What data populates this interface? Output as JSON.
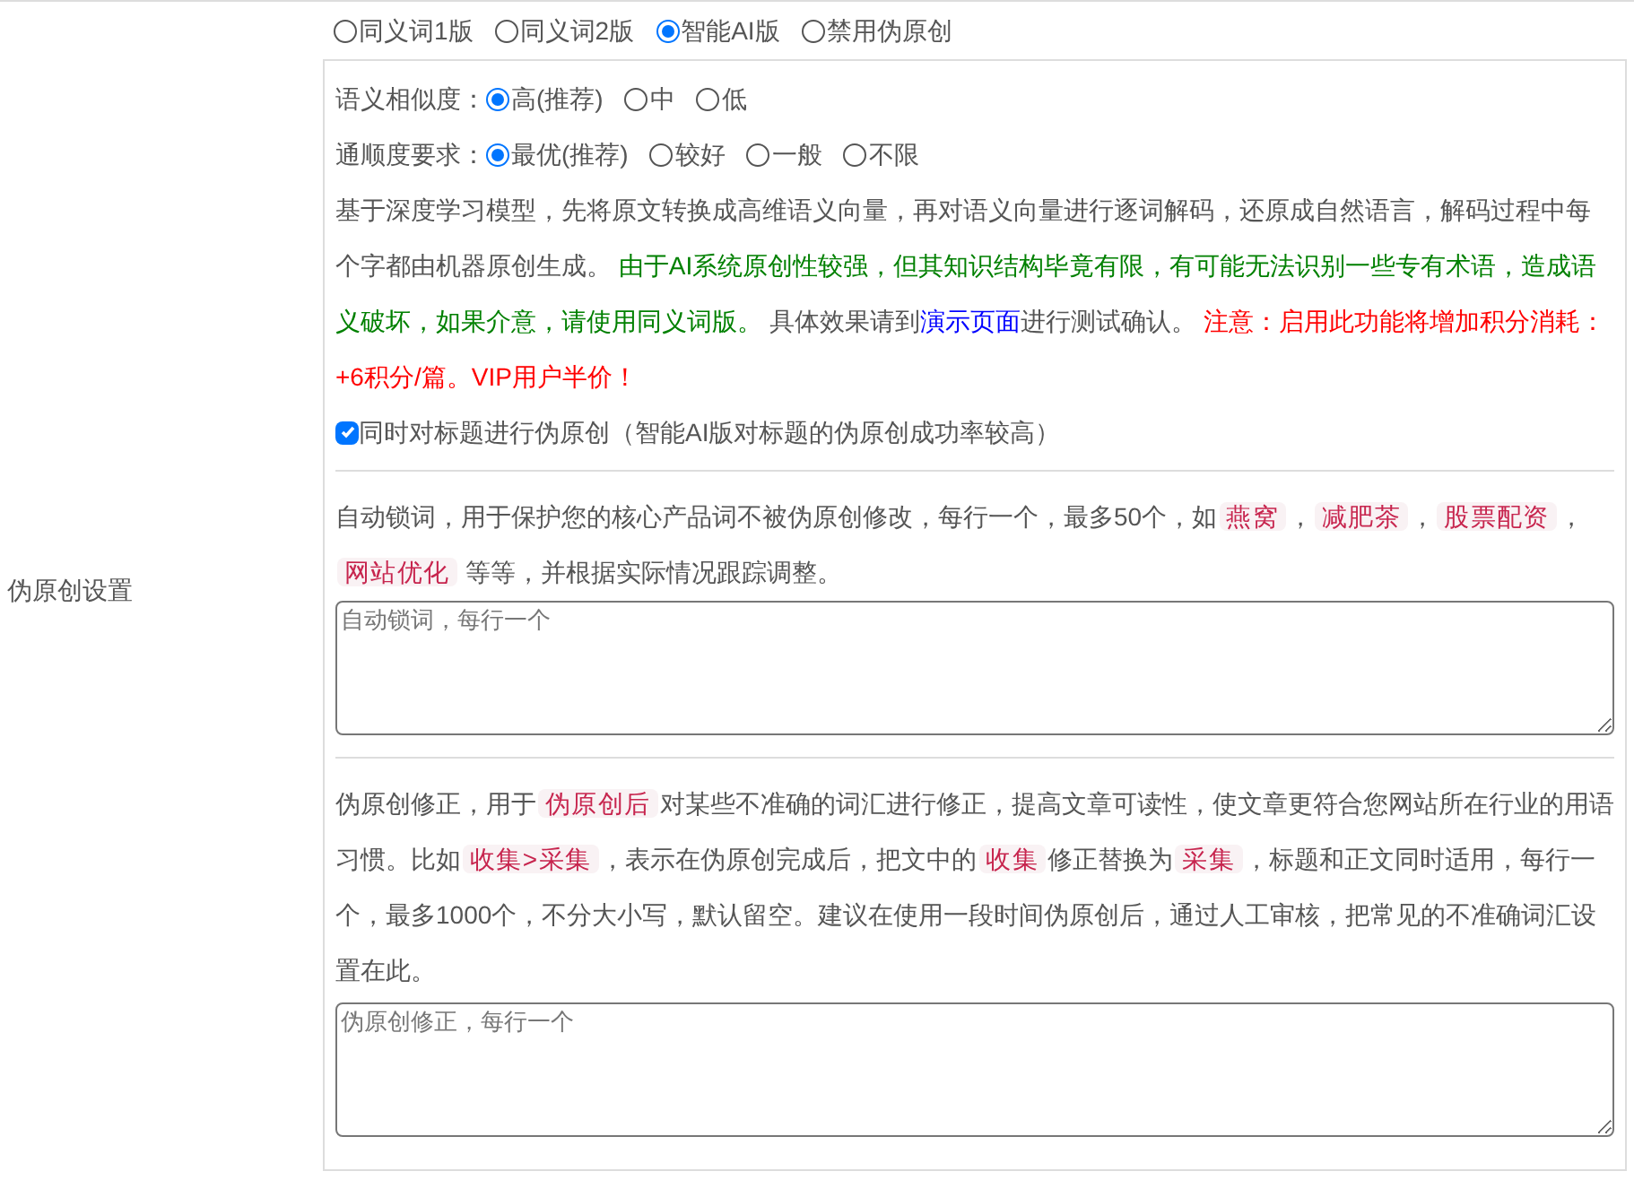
{
  "section_label": "伪原创设置",
  "modes": [
    {
      "label": "同义词1版",
      "selected": false
    },
    {
      "label": "同义词2版",
      "selected": false
    },
    {
      "label": "智能AI版",
      "selected": true
    },
    {
      "label": "禁用伪原创",
      "selected": false
    }
  ],
  "option_groups": [
    {
      "label": "语义相似度：",
      "options": [
        {
          "label": "高(推荐)",
          "selected": true
        },
        {
          "label": "中",
          "selected": false
        },
        {
          "label": "低",
          "selected": false
        }
      ]
    },
    {
      "label": "通顺度要求：",
      "options": [
        {
          "label": "最优(推荐)",
          "selected": true
        },
        {
          "label": "较好",
          "selected": false
        },
        {
          "label": "一般",
          "selected": false
        },
        {
          "label": "不限",
          "selected": false
        }
      ]
    }
  ],
  "ai_description": [
    {
      "kind": "plain",
      "text": "基于深度学习模型，先将原文转换成高维语义向量，再对语义向量进行逐词解码，还原成自然语言，解码过程中每个字都由机器原创生成。 "
    },
    {
      "kind": "green",
      "text": "由于AI系统原创性较强，但其知识结构毕竟有限，有可能无法识别一些专有术语，造成语义破坏，如果介意，请使用同义词版。"
    },
    {
      "kind": "plain",
      "text": " 具体效果请到"
    },
    {
      "kind": "link",
      "text": "演示页面"
    },
    {
      "kind": "plain",
      "text": "进行测试确认。 "
    },
    {
      "kind": "red",
      "text": "注意：启用此功能将增加积分消耗：+6积分/篇。VIP用户半价！"
    }
  ],
  "title_option": {
    "label": "同时对标题进行伪原创（智能AI版对标题的伪原创成功率较高）",
    "checked": true
  },
  "lock_words": {
    "description": [
      {
        "kind": "plain",
        "text": "自动锁词，用于保护您的核心产品词不被伪原创修改，每行一个，最多50个，如"
      },
      {
        "kind": "code",
        "text": "燕窝"
      },
      {
        "kind": "plain",
        "text": "，"
      },
      {
        "kind": "code",
        "text": "减肥茶"
      },
      {
        "kind": "plain",
        "text": "，"
      },
      {
        "kind": "code",
        "text": "股票配资"
      },
      {
        "kind": "plain",
        "text": "，"
      },
      {
        "kind": "code",
        "text": "网站优化"
      },
      {
        "kind": "plain",
        "text": " 等等，并根据实际情况跟踪调整。"
      }
    ],
    "placeholder": "自动锁词，每行一个"
  },
  "corrections": {
    "description": [
      {
        "kind": "plain",
        "text": "伪原创修正，用于"
      },
      {
        "kind": "code",
        "text": "伪原创后"
      },
      {
        "kind": "plain",
        "text": "对某些不准确的词汇进行修正，提高文章可读性，使文章更符合您网站所在行业的用语习惯。比如"
      },
      {
        "kind": "code",
        "text": "收集>采集"
      },
      {
        "kind": "plain",
        "text": "，表示在伪原创完成后，把文中的"
      },
      {
        "kind": "code",
        "text": "收集"
      },
      {
        "kind": "plain",
        "text": "修正替换为"
      },
      {
        "kind": "code",
        "text": "采集"
      },
      {
        "kind": "plain",
        "text": "，标题和正文同时适用，每行一个，最多1000个，不分大小写，默认留空。建议在使用一段时间伪原创后，通过人工审核，把常见的不准确词汇设置在此。"
      }
    ],
    "placeholder": "伪原创修正，每行一个"
  }
}
